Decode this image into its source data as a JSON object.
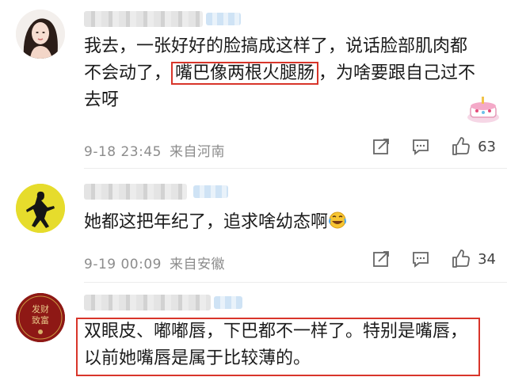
{
  "comments": [
    {
      "text_before": "我去，一张好好的脸搞成这样了，说话脸部肌肉都不会动了，",
      "highlight": "嘴巴像两根火腿肠",
      "text_after": "，为啥要跟自己过不去呀",
      "date": "9-18 23:45",
      "location": "来自河南",
      "likes": "63",
      "avatar": "woman-portrait-avatar",
      "sticker": "cake-sticker-icon"
    },
    {
      "text": "她都这把年纪了，追求啥幼态啊",
      "emoji": "laugh-cry-emoji-icon",
      "date": "9-19 00:09",
      "location": "来自安徽",
      "likes": "34",
      "avatar": "yellow-figure-avatar"
    },
    {
      "text": "双眼皮、嘟嘟唇，下巴都不一样了。特别是嘴唇，以前她嘴唇是属于比较薄的。",
      "avatar": "red-seal-avatar",
      "avatar_text": "发财致富"
    }
  ],
  "colors": {
    "highlight_border": "#d8352a",
    "meta": "#8c8c8c"
  }
}
